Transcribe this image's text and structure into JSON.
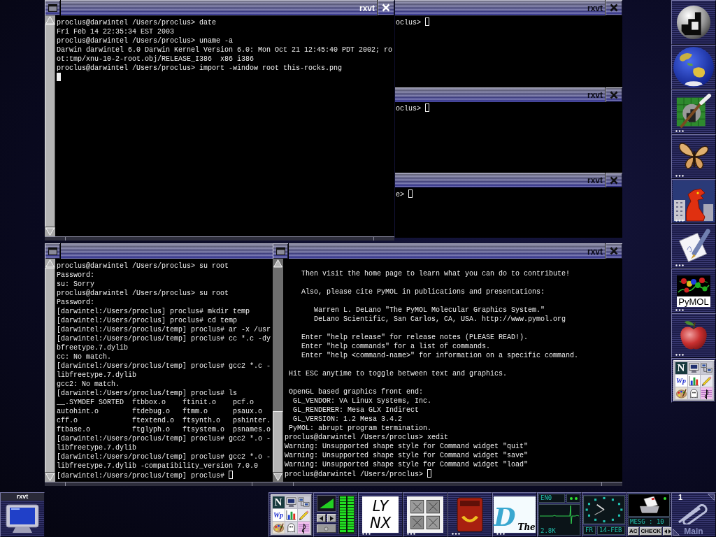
{
  "windows": [
    {
      "title": "rxvt",
      "focused": true,
      "blocks": [
        [
          "proclus@darwintel /Users/proclus> date",
          "Fri Feb 14 22:35:34 EST 2003",
          "proclus@darwintel /Users/proclus> uname -a",
          "Darwin darwintel 6.0 Darwin Kernel Version 6.0: Mon Oct 21 12:45:40 PDT 2002; ro",
          "ot:tmp/xnu-10-2-root.obj/RELEASE_I386  x86 i386",
          "proclus@darwintel /Users/proclus> import -window root this-rocks.png"
        ]
      ]
    },
    {
      "title": "rxvt",
      "focused": false,
      "prompt": "oclus>"
    },
    {
      "title": "rxvt",
      "focused": false,
      "prompt": "oclus>"
    },
    {
      "title": "rxvt",
      "focused": false,
      "prompt": "e>"
    },
    {
      "focused": false,
      "blocks": [
        [
          "proclus@darwintel /Users/proclus> su root",
          "Password:",
          "su: Sorry",
          "proclus@darwintel /Users/proclus> su root",
          "Password:",
          "[darwintel:/Users/proclus] proclus# mkdir temp",
          "[darwintel:/Users/proclus] proclus# cd temp",
          "[darwintel:/Users/proclus/temp] proclus# ar -x /usr",
          "[darwintel:/Users/proclus/temp] proclus# cc *.c -dy",
          "bfreetype.7.dylib",
          "cc: No match.",
          "[darwintel:/Users/proclus/temp] proclus# gcc2 *.c -",
          "libfreetype.7.dylib",
          "gcc2: No match.",
          "[darwintel:/Users/proclus/temp] proclus# ls",
          "__.SYMDEF SORTED  ftbbox.o    ftinit.o    pcf.o",
          "autohint.o        ftdebug.o   ftmm.o      psaux.o",
          "cff.o             ftextend.o  ftsynth.o   pshinter.",
          "ftbase.o          ftglyph.o   ftsystem.o  psnames.o",
          "[darwintel:/Users/proclus/temp] proclus# gcc2 *.o -",
          "libfreetype.7.dylib",
          "[darwintel:/Users/proclus/temp] proclus# gcc2 *.o -",
          "libfreetype.7.dylib -compatibility_version 7.0.0"
        ]
      ],
      "prompt": "[darwintel:/Users/proclus/temp] proclus#"
    },
    {
      "title": "rxvt",
      "focused": false,
      "blocks": [
        [
          "    Then visit the home page to learn what you can do to contribute!"
        ],
        [
          "    Also, please cite PyMOL in publications and presentations:"
        ],
        [
          "       Warren L. DeLano \"The PyMOL Molecular Graphics System.\"",
          "       DeLano Scientific, San Carlos, CA, USA. http://www.pymol.org"
        ],
        [
          "    Enter \"help release\" for release notes (PLEASE READ!).",
          "    Enter \"help commands\" for a list of commands.",
          "    Enter \"help <command-name>\" for information on a specific command."
        ],
        [
          " Hit ESC anytime to toggle between text and graphics."
        ],
        [
          " OpenGL based graphics front end:",
          "  GL_VENDOR: VA Linux Systems, Inc.",
          "  GL_RENDERER: Mesa GLX Indirect",
          "  GL_VERSION: 1.2 Mesa 3.4.2",
          " PyMOL: abrupt program termination.",
          "proclus@darwintel /Users/proclus> xedit",
          "Warning: Unsupported shape style for Command widget \"quit\"",
          "Warning: Unsupported shape style for Command widget \"save\"",
          "Warning: Unsupported shape style for Command widget \"load\""
        ]
      ],
      "prompt": "proclus@darwintel /Users/proclus>"
    }
  ],
  "dock": {
    "tiles": [
      {
        "kind": "sphere",
        "running": true
      },
      {
        "kind": "globe",
        "running": true
      },
      {
        "kind": "brush",
        "running": false
      },
      {
        "kind": "butterfly",
        "running": false
      },
      {
        "kind": "dragon",
        "running": false
      },
      {
        "kind": "pen",
        "running": false
      },
      {
        "kind": "molecule",
        "label": "PyMOL",
        "running": false
      },
      {
        "kind": "apple",
        "running": false
      },
      {
        "kind": "grid",
        "running": true,
        "grid": [
          {
            "kind": "monogram",
            "text": "N"
          },
          {
            "kind": "monitor"
          },
          {
            "kind": "network"
          },
          {
            "kind": "script",
            "text": "Wp"
          },
          {
            "kind": "chart"
          },
          {
            "kind": "pencil"
          },
          {
            "kind": "palette"
          },
          {
            "kind": "ghost"
          },
          {
            "kind": "music"
          }
        ]
      }
    ]
  },
  "clip": {
    "tiles": [
      {
        "kind": "grid",
        "running": true,
        "grid": [
          {
            "kind": "monogram",
            "text": "N"
          },
          {
            "kind": "monitor"
          },
          {
            "kind": "network"
          },
          {
            "kind": "script",
            "text": "Wp"
          },
          {
            "kind": "chart"
          },
          {
            "kind": "pencil"
          },
          {
            "kind": "palette"
          },
          {
            "kind": "ghost"
          },
          {
            "kind": "music"
          }
        ]
      },
      {
        "kind": "mixer",
        "running": true,
        "level": 1
      },
      {
        "kind": "lynx",
        "running": false,
        "logo": [
          "LY",
          "NX"
        ]
      },
      {
        "kind": "ornament",
        "running": false
      },
      {
        "kind": "mailbox",
        "running": false
      },
      {
        "kind": "dlogo",
        "running": false,
        "letter": "D",
        "word": "The"
      },
      {
        "kind": "netmon",
        "running": true,
        "interface": "EN0",
        "rate": "2.8K"
      },
      {
        "kind": "clock",
        "running": true,
        "day": "FR",
        "date": "14-FEB"
      },
      {
        "kind": "mail",
        "running": true,
        "message": "MESG : 10",
        "buttons": [
          "AC",
          "CHECK"
        ]
      },
      {
        "kind": "workspace",
        "running": true,
        "number": "1",
        "name": "Main"
      }
    ]
  },
  "miniwindow": {
    "title": "rxvt"
  }
}
